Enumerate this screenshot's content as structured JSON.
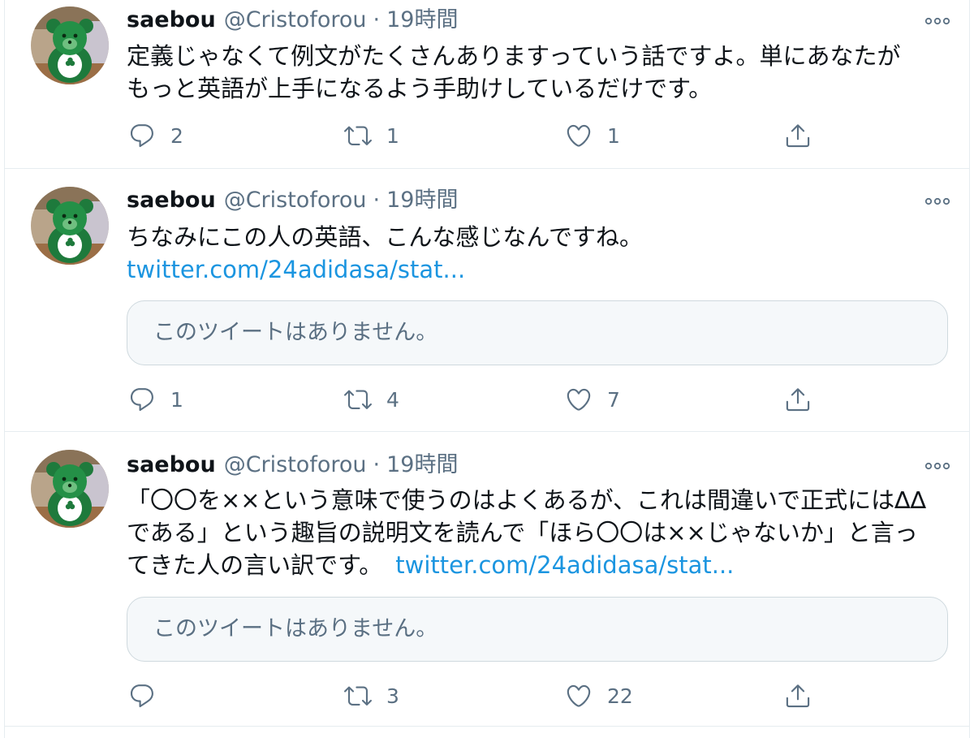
{
  "tweets": [
    {
      "author_name": "saebou",
      "handle": "@Cristoforou",
      "separator": "·",
      "time": "19時間",
      "text_lines": [
        "定義じゃなくて例文がたくさんありますっていう話ですよ。単にあなたが",
        "もっと英語が上手になるよう手助けしているだけです。"
      ],
      "reply_count": "2",
      "retweet_count": "1",
      "like_count": "1"
    },
    {
      "author_name": "saebou",
      "handle": "@Cristoforou",
      "separator": "·",
      "time": "19時間",
      "text_lines": [
        "ちなみにこの人の英語、こんな感じなんですね。"
      ],
      "link": "twitter.com/24adidasa/stat...",
      "quote_text": "このツイートはありません。",
      "reply_count": "1",
      "retweet_count": "4",
      "like_count": "7"
    },
    {
      "author_name": "saebou",
      "handle": "@Cristoforou",
      "separator": "·",
      "time": "19時間",
      "text_lines": [
        "「〇〇を××という意味で使うのはよくあるが、これは間違いで正式には∆∆",
        "である」という趣旨の説明文を読んで「ほら〇〇は××じゃないか」と言っ",
        "てきた人の言い訳です。"
      ],
      "link": "twitter.com/24adidasa/stat...",
      "quote_text": "このツイートはありません。",
      "reply_count": "",
      "retweet_count": "3",
      "like_count": "22"
    }
  ],
  "icons": {
    "reply": "reply-icon",
    "retweet": "retweet-icon",
    "like": "heart-icon",
    "share": "share-icon",
    "more": "more-icon"
  },
  "colors": {
    "text": "#0f1419",
    "secondary": "#5b7083",
    "link": "#1b95e0",
    "border": "#e6ecf0",
    "quote_background": "#f5f8fa",
    "avatar_bear": "#1e7a3c"
  }
}
